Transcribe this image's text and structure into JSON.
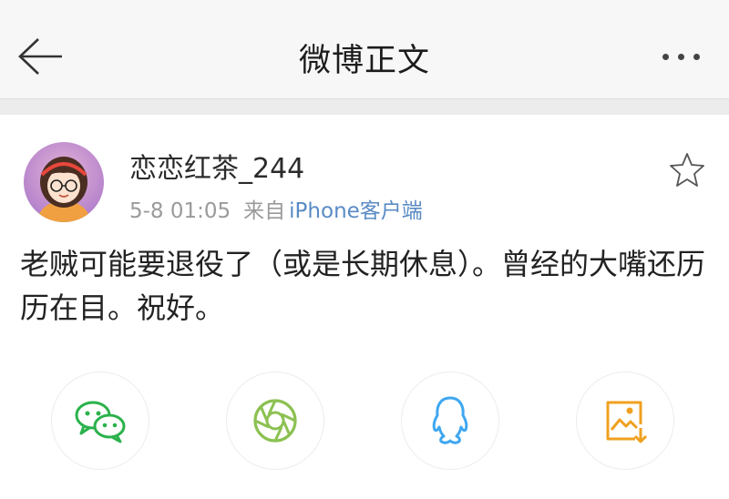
{
  "navbar": {
    "title": "微博正文",
    "back_icon": "arrow-left-icon",
    "more_icon": "more-dots-icon"
  },
  "post": {
    "username": "恋恋红茶_244",
    "time": "5-8 01:05",
    "source_label": "来自",
    "source_device": "iPhone客户端",
    "text": "老贼可能要退役了（或是长期休息）。曾经的大嘴还历历在目。祝好。",
    "favorite_icon": "star-icon"
  },
  "share": {
    "items": [
      {
        "icon": "wechat-icon",
        "color": "#2bb24c"
      },
      {
        "icon": "moments-icon",
        "color": "#8cc152"
      },
      {
        "icon": "qq-icon",
        "color": "#3fa7f0"
      },
      {
        "icon": "save-image-icon",
        "color": "#f0a020"
      }
    ]
  }
}
